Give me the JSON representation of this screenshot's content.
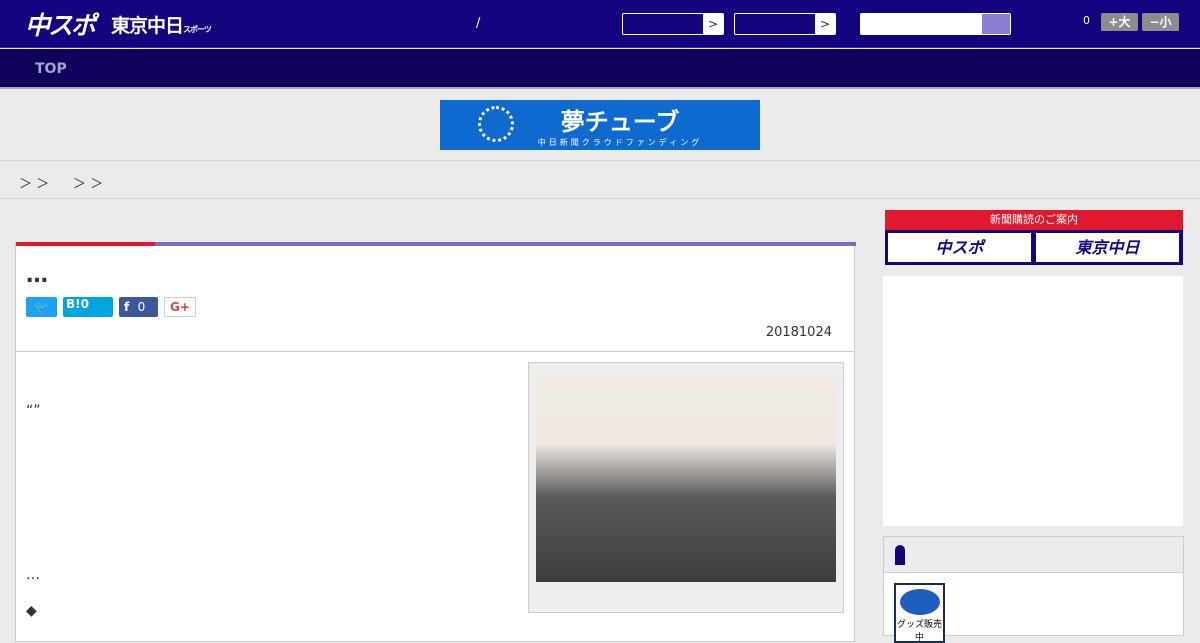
{
  "header": {
    "logo_chuspo": "中スポ",
    "logo_tokyo": "東京中日",
    "logo_tokyo_sub": "スポーツ",
    "slash": "/",
    "select_arrow": ">",
    "count": "0",
    "font_large": "+大",
    "font_small": "−小"
  },
  "nav": {
    "top": "TOP"
  },
  "banner": {
    "title": "夢チューブ",
    "subtitle": "中日新聞クラウドファンディング"
  },
  "breadcrumb": {
    "sep1": "＞ ＞",
    "sep2": "＞ ＞"
  },
  "article": {
    "title": "…",
    "hatena": "B!0",
    "facebook_count": "0",
    "gplus": "G+",
    "date": "20181024",
    "quote": "“”",
    "ellipsis": "…",
    "diamond": "◆"
  },
  "sidebar": {
    "subscribe_header": "新聞購読のご案内",
    "subscribe_chuspo": "中スポ",
    "subscribe_tokyo": "東京中日",
    "goods_label": "グッズ販売中"
  },
  "colors": {
    "header": "#14047f",
    "nav": "#10015a",
    "accent_red": "#e0192e",
    "accent_purple": "#7a6cc0"
  }
}
